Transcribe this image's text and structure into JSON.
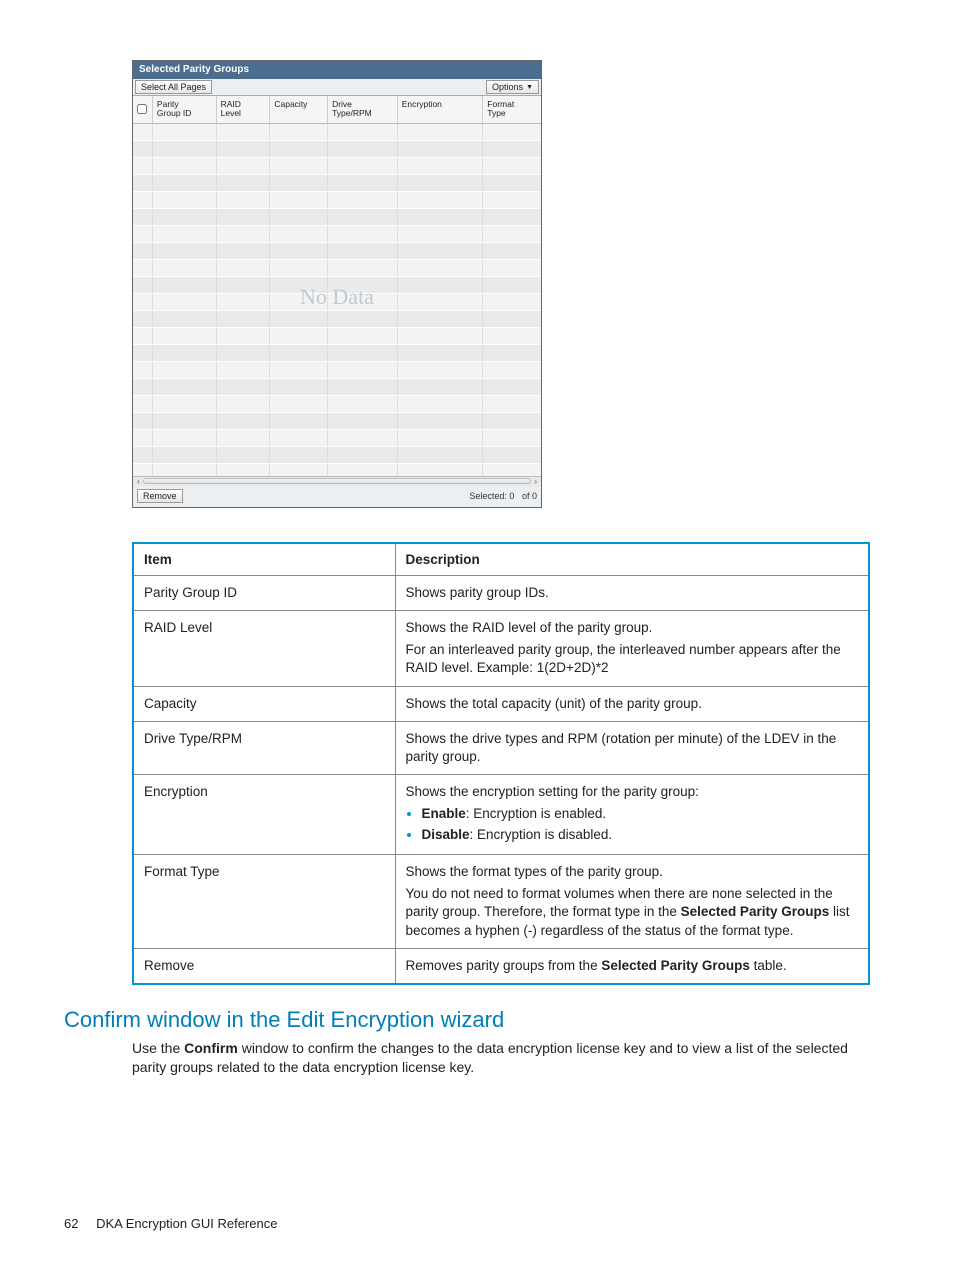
{
  "panel": {
    "title": "Selected Parity Groups",
    "select_all": "Select All Pages",
    "options": "Options",
    "columns": {
      "parity_group_id": "Parity\nGroup ID",
      "raid_level": "RAID\nLevel",
      "capacity": "Capacity",
      "drive_type_rpm": "Drive\nType/RPM",
      "encryption": "Encryption",
      "format_type": "Format\nType"
    },
    "no_data": "No Data",
    "remove": "Remove",
    "selected_label": "Selected:",
    "selected_count": "0",
    "of_label": "of",
    "total_count": "0"
  },
  "desc_table": {
    "head_item": "Item",
    "head_desc": "Description",
    "rows": {
      "pg": {
        "item": "Parity Group ID",
        "desc": "Shows parity group IDs."
      },
      "raid": {
        "item": "RAID Level",
        "desc1": "Shows the RAID level of the parity group.",
        "desc2": "For an interleaved parity group, the interleaved number appears after the RAID level. Example: 1(2D+2D)*2"
      },
      "cap": {
        "item": "Capacity",
        "desc": "Shows the total capacity (unit) of the parity group."
      },
      "drv": {
        "item": "Drive Type/RPM",
        "desc": "Shows the drive types and RPM (rotation per minute) of the LDEV in the parity group."
      },
      "enc": {
        "item": "Encryption",
        "desc_intro": "Shows the encryption setting for the parity group:",
        "li1_b": "Enable",
        "li1_t": ": Encryption is enabled.",
        "li2_b": "Disable",
        "li2_t": ": Encryption is disabled."
      },
      "fmt": {
        "item": "Format Type",
        "desc1": "Shows the format types of the parity group.",
        "desc2a": "You do not need to format volumes when there are none selected in the parity group. Therefore, the format type in the ",
        "desc2b": "Selected Parity Groups",
        "desc2c": " list becomes a hyphen (-) regardless of the status of the format type."
      },
      "rem": {
        "item": "Remove",
        "desc_a": "Removes parity groups from the ",
        "desc_b": "Selected Parity Groups",
        "desc_c": " table."
      }
    }
  },
  "section": {
    "heading": "Confirm window in the Edit Encryption wizard",
    "para_a": "Use the ",
    "para_b": "Confirm",
    "para_c": " window to confirm the changes to the data encryption license key and to view a list of the selected parity groups related to the data encryption license key."
  },
  "footer": {
    "page": "62",
    "title": "DKA Encryption GUI Reference"
  }
}
